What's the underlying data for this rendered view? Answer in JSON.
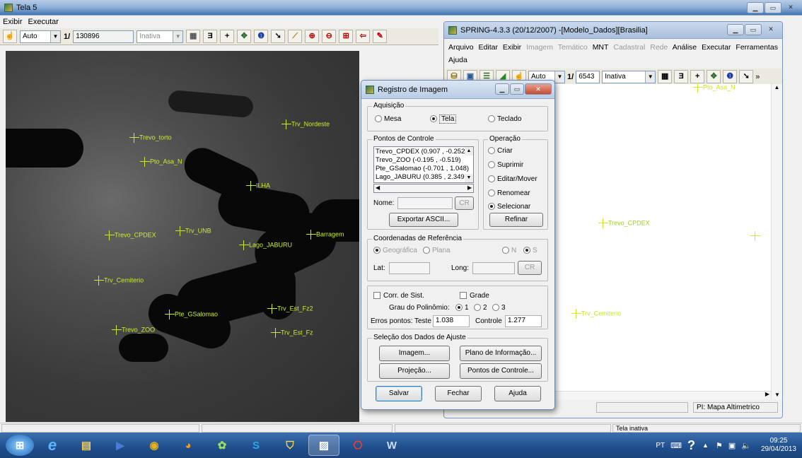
{
  "left_window": {
    "title": "Tela 5",
    "menu": [
      "Exibir",
      "Executar"
    ],
    "toolbar": {
      "zoom_mode": "Auto",
      "scale_prefix": "1/",
      "scale_value": "130896",
      "layer_state": "Inativa"
    }
  },
  "map_markers": [
    "Trv_Nordeste",
    "Trevo_torto",
    "Pto_Asa_N",
    "ILHA",
    "Trevo_CPDEX",
    "Trv_UNB",
    "Lago_JABURU",
    "Barragem",
    "Trv_Cemiterio",
    "Trv_Est_Fz2",
    "Pte_GSalomao",
    "Trevo_ZOO",
    "Trv_Est_Fz"
  ],
  "spring_window": {
    "title": "SPRING-4.3.3 (20/12/2007) -[Modelo_Dados][Brasilia]",
    "menu": [
      {
        "label": "Arquivo",
        "enabled": true
      },
      {
        "label": "Editar",
        "enabled": true
      },
      {
        "label": "Exibir",
        "enabled": true
      },
      {
        "label": "Imagem",
        "enabled": false
      },
      {
        "label": "Temático",
        "enabled": false
      },
      {
        "label": "MNT",
        "enabled": true
      },
      {
        "label": "Cadastral",
        "enabled": false
      },
      {
        "label": "Rede",
        "enabled": false
      },
      {
        "label": "Análise",
        "enabled": true
      },
      {
        "label": "Executar",
        "enabled": true
      },
      {
        "label": "Ferramentas",
        "enabled": true
      },
      {
        "label": "Ajuda",
        "enabled": true
      }
    ],
    "toolbar": {
      "zoom_mode": "Auto",
      "scale_prefix": "1/",
      "scale_value": "6543",
      "layer_state": "Inativa",
      "more": "»"
    },
    "markers": [
      "Pto_Asa_N",
      "Trevo_CPDEX",
      "Trv_Cemiterio"
    ],
    "status_pi": "PI: Mapa Altimetrico"
  },
  "dialog": {
    "title": "Registro de Imagem",
    "aquisicao": {
      "legend": "Aquisição",
      "options": [
        "Mesa",
        "Tela",
        "Teclado"
      ],
      "selected": "Tela"
    },
    "pontos": {
      "legend": "Pontos de Controle",
      "items": [
        "Trevo_CPDEX (0.907 , -0.252)",
        "Trevo_ZOO (-0.195 , -0.519)",
        "Pte_GSalomao (-0.701 , 1.048)",
        "Lago_JABURU (0.385 , 2.349)"
      ],
      "nome_label": "Nome:",
      "cr": "CR",
      "export": "Exportar ASCII..."
    },
    "operacao": {
      "legend": "Operação",
      "options": [
        "Criar",
        "Suprimir",
        "Editar/Mover",
        "Renomear",
        "Selecionar"
      ],
      "selected": "Selecionar",
      "refinar": "Refinar"
    },
    "coords": {
      "legend": "Coordenadas de Referência",
      "options": [
        "Geográfica",
        "Plana"
      ],
      "ns": [
        "N",
        "S"
      ],
      "lat": "Lat:",
      "long": "Long:",
      "cr": "CR"
    },
    "corr": {
      "corr_sist": "Corr. de Sist.",
      "grade": "Grade",
      "grau_label": "Grau do Polinômio:",
      "grau": [
        "1",
        "2",
        "3"
      ],
      "erros_label": "Erros pontos:",
      "teste_label": "Teste",
      "teste": "1.038",
      "controle_label": "Controle",
      "controle": "1.277"
    },
    "selecao": {
      "legend": "Seleção dos Dados de Ajuste",
      "imagem": "Imagem...",
      "plano": "Plano de Informação...",
      "projecao": "Projeção...",
      "pontos": "Pontos de Controle..."
    },
    "buttons": {
      "salvar": "Salvar",
      "fechar": "Fechar",
      "ajuda": "Ajuda"
    }
  },
  "statusbar": {
    "text": "Tela inativa"
  },
  "tray": {
    "lang": "PT",
    "time": "09:25",
    "date": "29/04/2013"
  }
}
